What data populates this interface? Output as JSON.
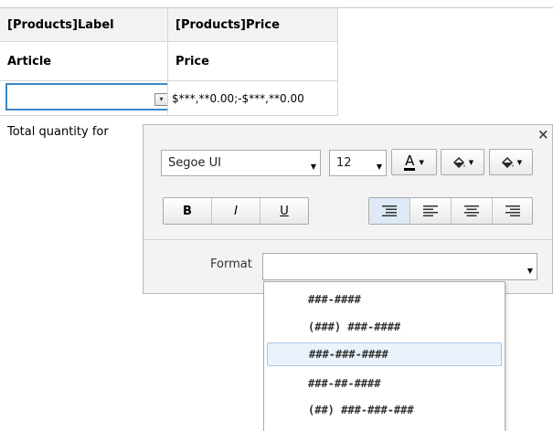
{
  "table": {
    "header": {
      "col1": "[Products]Label",
      "col2": "[Products]Price"
    },
    "row1": {
      "col1": "Article",
      "col2": "Price"
    },
    "row2": {
      "col1": "",
      "col2": "$***,**0.00;-$***,**0.00"
    },
    "row3": {
      "col1": "Total quantity for",
      "col2": ""
    }
  },
  "format_panel": {
    "font_family": "Segoe UI",
    "font_size": "12",
    "font_color_glyph": "A",
    "bold_label": "B",
    "italic_label": "I",
    "underline_label": "U",
    "format_label": "Format",
    "format_value": "",
    "format_options": [
      "###-####",
      "(###) ###-####",
      "###-###-####",
      "###-##-####",
      "(##) ###-###-###"
    ],
    "selected_option_index": 2,
    "close_glyph": "×"
  },
  "colors": {
    "selection_border": "#3a87c8",
    "selected_item_bg": "#eaf3fb",
    "panel_bg": "#f3f3f3",
    "active_align_bg": "#dde9f6"
  }
}
